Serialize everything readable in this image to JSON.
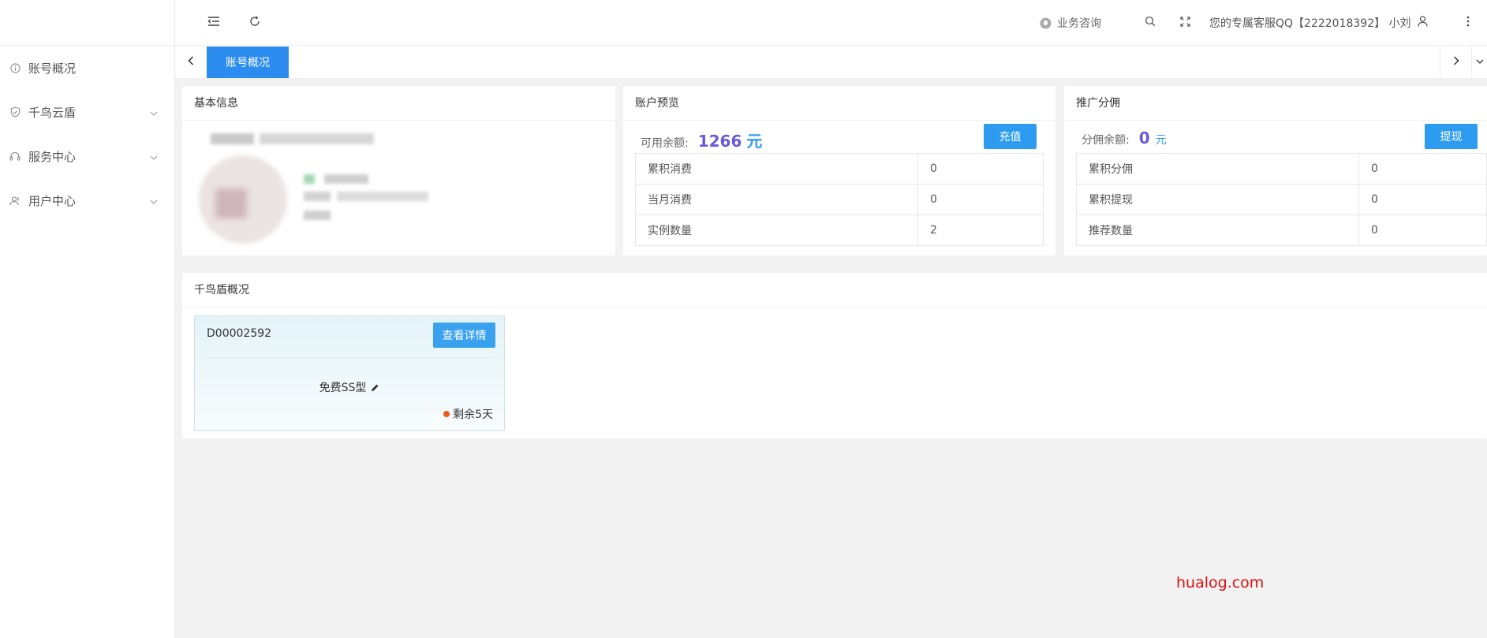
{
  "sidebar": {
    "items": [
      {
        "label": "账号概况",
        "icon": "info-circle-icon"
      },
      {
        "label": "千鸟云盾",
        "icon": "shield-check-icon"
      },
      {
        "label": "服务中心",
        "icon": "headset-icon"
      },
      {
        "label": "用户中心",
        "icon": "user-group-icon"
      }
    ]
  },
  "header": {
    "consult": "业务咨询",
    "service_text": "您的专属客服QQ【2222018392】 小刘"
  },
  "tabs": {
    "active": "账号概况"
  },
  "basic_info": {
    "title": "基本信息"
  },
  "account_preview": {
    "title": "账户预览",
    "balance_label": "可用余额:",
    "balance_value": "1266",
    "balance_unit": "元",
    "recharge_button": "充值",
    "rows": [
      {
        "label": "累积消费",
        "value": "0"
      },
      {
        "label": "当月消费",
        "value": "0"
      },
      {
        "label": "实例数量",
        "value": "2"
      }
    ]
  },
  "promotion": {
    "title": "推广分佣",
    "balance_label": "分佣余额:",
    "balance_value": "0",
    "balance_unit": "元",
    "withdraw_button": "提现",
    "rows": [
      {
        "label": "累积分佣",
        "value": "0"
      },
      {
        "label": "累积提现",
        "value": "0"
      },
      {
        "label": "推荐数量",
        "value": "0"
      }
    ]
  },
  "shield_overview": {
    "title": "千鸟盾概况",
    "instance": {
      "id": "D00002592",
      "detail_button": "查看详情",
      "plan": "免费SS型",
      "remaining": "剩余5天"
    }
  },
  "watermark": "hualog.com",
  "colors": {
    "primary": "#2d8cf0",
    "button": "#2d9cf0",
    "balance": "#6a5bd8",
    "status_dot": "#f05a1a",
    "watermark": "#e01010"
  }
}
